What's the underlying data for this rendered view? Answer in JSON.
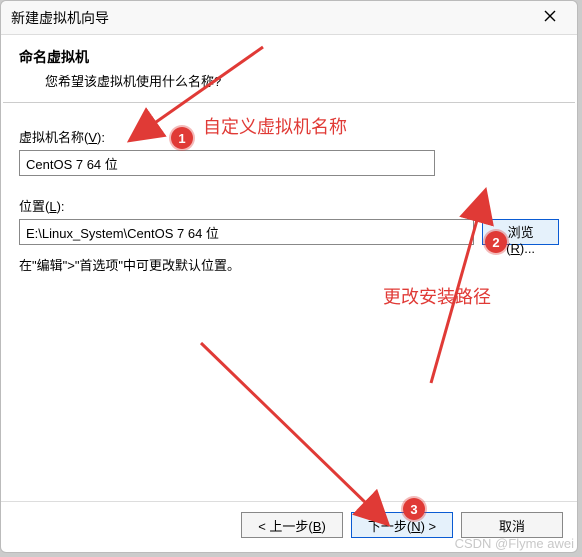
{
  "window": {
    "title": "新建虚拟机向导"
  },
  "header": {
    "heading": "命名虚拟机",
    "subheading": "您希望该虚拟机使用什么名称?"
  },
  "fields": {
    "name_label": "虚拟机名称(V):",
    "name_underline": "V",
    "name_value": "CentOS 7 64 位",
    "location_label": "位置(L):",
    "location_underline": "L",
    "location_value": "E:\\Linux_System\\CentOS 7 64 位",
    "browse_label": "浏览(R)..."
  },
  "note": "在\"编辑\">\"首选项\"中可更改默认位置。",
  "footer": {
    "back": "< 上一步(B)",
    "next": "下一步(N) >",
    "cancel": "取消"
  },
  "annotations": {
    "badge1": "1",
    "badge2": "2",
    "badge3": "3",
    "text1": "自定义虚拟机名称",
    "text2": "更改安装路径",
    "arrow_color": "#e03a36"
  },
  "watermark": "CSDN @Flyme awei"
}
